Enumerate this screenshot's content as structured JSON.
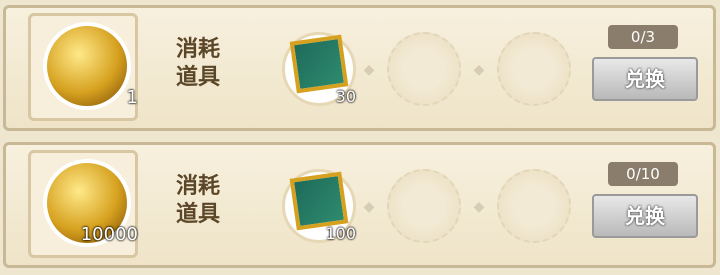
{
  "rows": [
    {
      "reward": {
        "icon": "golden-compass-icon",
        "count": "1"
      },
      "label": {
        "line1": "消耗",
        "line2": "道具"
      },
      "cost": {
        "icon": "jade-token-icon",
        "count": "30"
      },
      "progress": "0/3",
      "button": "兑换"
    },
    {
      "reward": {
        "icon": "copper-coins-icon",
        "count": "10000"
      },
      "label": {
        "line1": "消耗",
        "line2": "道具"
      },
      "cost": {
        "icon": "jade-token-icon",
        "count": "100"
      },
      "progress": "0/10",
      "button": "兑换"
    }
  ]
}
